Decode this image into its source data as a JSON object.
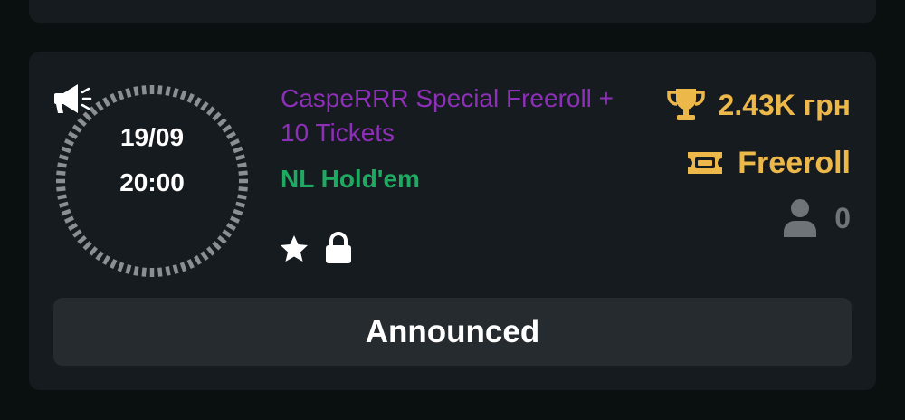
{
  "tournament": {
    "date": "19/09",
    "time": "20:00",
    "status_icon": "megaphone-icon",
    "title": "CaspeRRR Special Freeroll + 10 Tickets",
    "game": "NL Hold'em",
    "badges": [
      "star-icon",
      "lock-icon"
    ],
    "prize": "2.43K грн",
    "prize_icon": "trophy-icon",
    "type": "Freeroll",
    "type_icon": "ticket-icon",
    "players": "0",
    "players_icon": "user-icon",
    "status_button": "Announced"
  },
  "colors": {
    "background": "#0a100f",
    "card": "#161b20",
    "title": "#8e2fb9",
    "game": "#1eaa61",
    "gold": "#ecb84a",
    "muted": "#6f7479",
    "button": "#252b2f"
  }
}
